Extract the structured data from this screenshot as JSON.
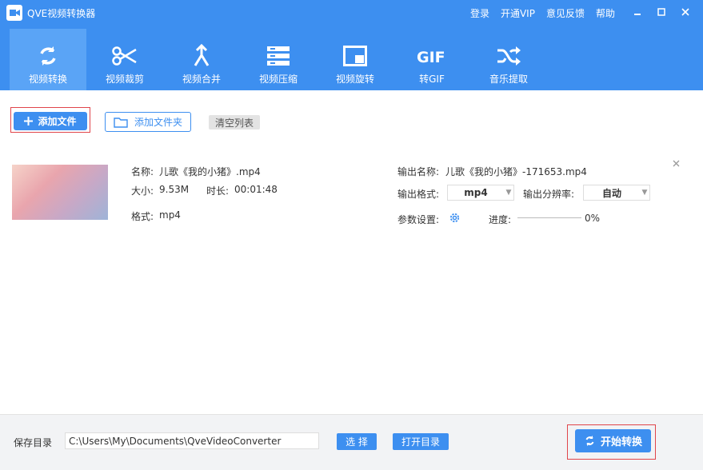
{
  "app": {
    "title": "QVE视频转换器"
  },
  "top_links": [
    "登录",
    "开通VIP",
    "意见反馈",
    "帮助"
  ],
  "toolbar": [
    {
      "label": "视频转换",
      "icon": "refresh-icon"
    },
    {
      "label": "视频裁剪",
      "icon": "scissors-icon"
    },
    {
      "label": "视频合并",
      "icon": "merge-icon"
    },
    {
      "label": "视频压缩",
      "icon": "compress-icon"
    },
    {
      "label": "视频旋转",
      "icon": "rotate-icon"
    },
    {
      "label": "转GIF",
      "icon": "gif-icon"
    },
    {
      "label": "音乐提取",
      "icon": "shuffle-icon"
    }
  ],
  "actions": {
    "add_file": "添加文件",
    "add_folder": "添加文件夹",
    "clear_list": "清空列表"
  },
  "file": {
    "name_label": "名称:",
    "name": "儿歌《我的小猪》.mp4",
    "size_label": "大小:",
    "size": "9.53M",
    "duration_label": "时长:",
    "duration": "00:01:48",
    "format_label": "格式:",
    "format": "mp4",
    "output_name_label": "输出名称:",
    "output_name": "儿歌《我的小猪》-171653.mp4",
    "output_format_label": "输出格式:",
    "output_format": "mp4",
    "resolution_label": "输出分辨率:",
    "resolution": "自动",
    "params_label": "参数设置:",
    "progress_label": "进度:",
    "progress": "0%"
  },
  "footer": {
    "save_dir_label": "保存目录",
    "save_dir": "C:\\Users\\My\\Documents\\QveVideoConverter",
    "choose": "选 择",
    "open_dir": "打开目录",
    "start": "开始转换"
  },
  "colors": {
    "accent": "#3d8ff0",
    "highlight": "#e0454b"
  }
}
